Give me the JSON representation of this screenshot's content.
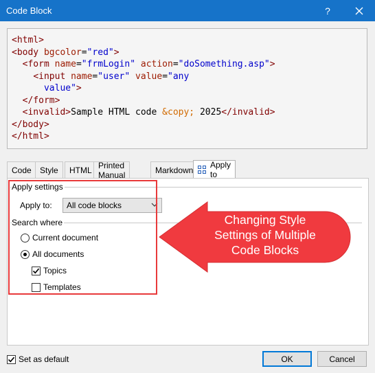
{
  "window": {
    "title": "Code Block",
    "help_label": "?"
  },
  "code_lines": [
    [
      {
        "c": "tag",
        "t": "<html>"
      }
    ],
    [
      {
        "c": "tag",
        "t": "<body"
      },
      {
        "c": "attr",
        "t": " bgcolor"
      },
      {
        "c": "plain",
        "t": "="
      },
      {
        "c": "val",
        "t": "\"red\""
      },
      {
        "c": "tag",
        "t": ">"
      }
    ],
    [
      {
        "c": "plain",
        "t": "  "
      },
      {
        "c": "tag",
        "t": "<form"
      },
      {
        "c": "attr",
        "t": " name"
      },
      {
        "c": "plain",
        "t": "="
      },
      {
        "c": "val",
        "t": "\"frmLogin\""
      },
      {
        "c": "attr",
        "t": " action"
      },
      {
        "c": "plain",
        "t": "="
      },
      {
        "c": "val",
        "t": "\"doSomething.asp\""
      },
      {
        "c": "tag",
        "t": ">"
      }
    ],
    [
      {
        "c": "plain",
        "t": "    "
      },
      {
        "c": "tag",
        "t": "<input"
      },
      {
        "c": "attr",
        "t": " name"
      },
      {
        "c": "plain",
        "t": "="
      },
      {
        "c": "val",
        "t": "\"user\""
      },
      {
        "c": "attr",
        "t": " value"
      },
      {
        "c": "plain",
        "t": "="
      },
      {
        "c": "val",
        "t": "\"any"
      }
    ],
    [
      {
        "c": "val",
        "t": "      value\""
      },
      {
        "c": "tag",
        "t": ">"
      }
    ],
    [
      {
        "c": "plain",
        "t": "  "
      },
      {
        "c": "tag",
        "t": "</form>"
      }
    ],
    [
      {
        "c": "plain",
        "t": "  "
      },
      {
        "c": "tag",
        "t": "<invalid>"
      },
      {
        "c": "plain",
        "t": "Sample HTML code "
      },
      {
        "c": "ent",
        "t": "&copy;"
      },
      {
        "c": "plain",
        "t": " 2025"
      },
      {
        "c": "tag",
        "t": "</invalid>"
      }
    ],
    [
      {
        "c": "tag",
        "t": "</body>"
      }
    ],
    [
      {
        "c": "tag",
        "t": "</html>"
      }
    ]
  ],
  "tabs": [
    {
      "label": "Code"
    },
    {
      "label": "Style"
    },
    {
      "label": "HTML"
    },
    {
      "label": "Printed Manual"
    },
    {
      "label": "Markdown"
    },
    {
      "label": "Apply to",
      "icon": "grid-icon",
      "active": true
    }
  ],
  "apply_settings": {
    "group_label": "Apply settings",
    "apply_to_label": "Apply to:",
    "apply_to_value": "All code blocks"
  },
  "search_where": {
    "group_label": "Search where",
    "current_document": "Current document",
    "all_documents": "All documents",
    "topics": "Topics",
    "templates": "Templates",
    "selected": "all_documents",
    "topics_checked": true,
    "templates_checked": false
  },
  "callout": {
    "text": "Changing Style Settings of Multiple Code Blocks",
    "color": "#f03a3f"
  },
  "footer": {
    "set_as_default": "Set as default",
    "set_as_default_checked": true,
    "ok_label": "OK",
    "cancel_label": "Cancel"
  },
  "colors": {
    "titlebar": "#1673c9",
    "highlight": "#e8393a"
  }
}
